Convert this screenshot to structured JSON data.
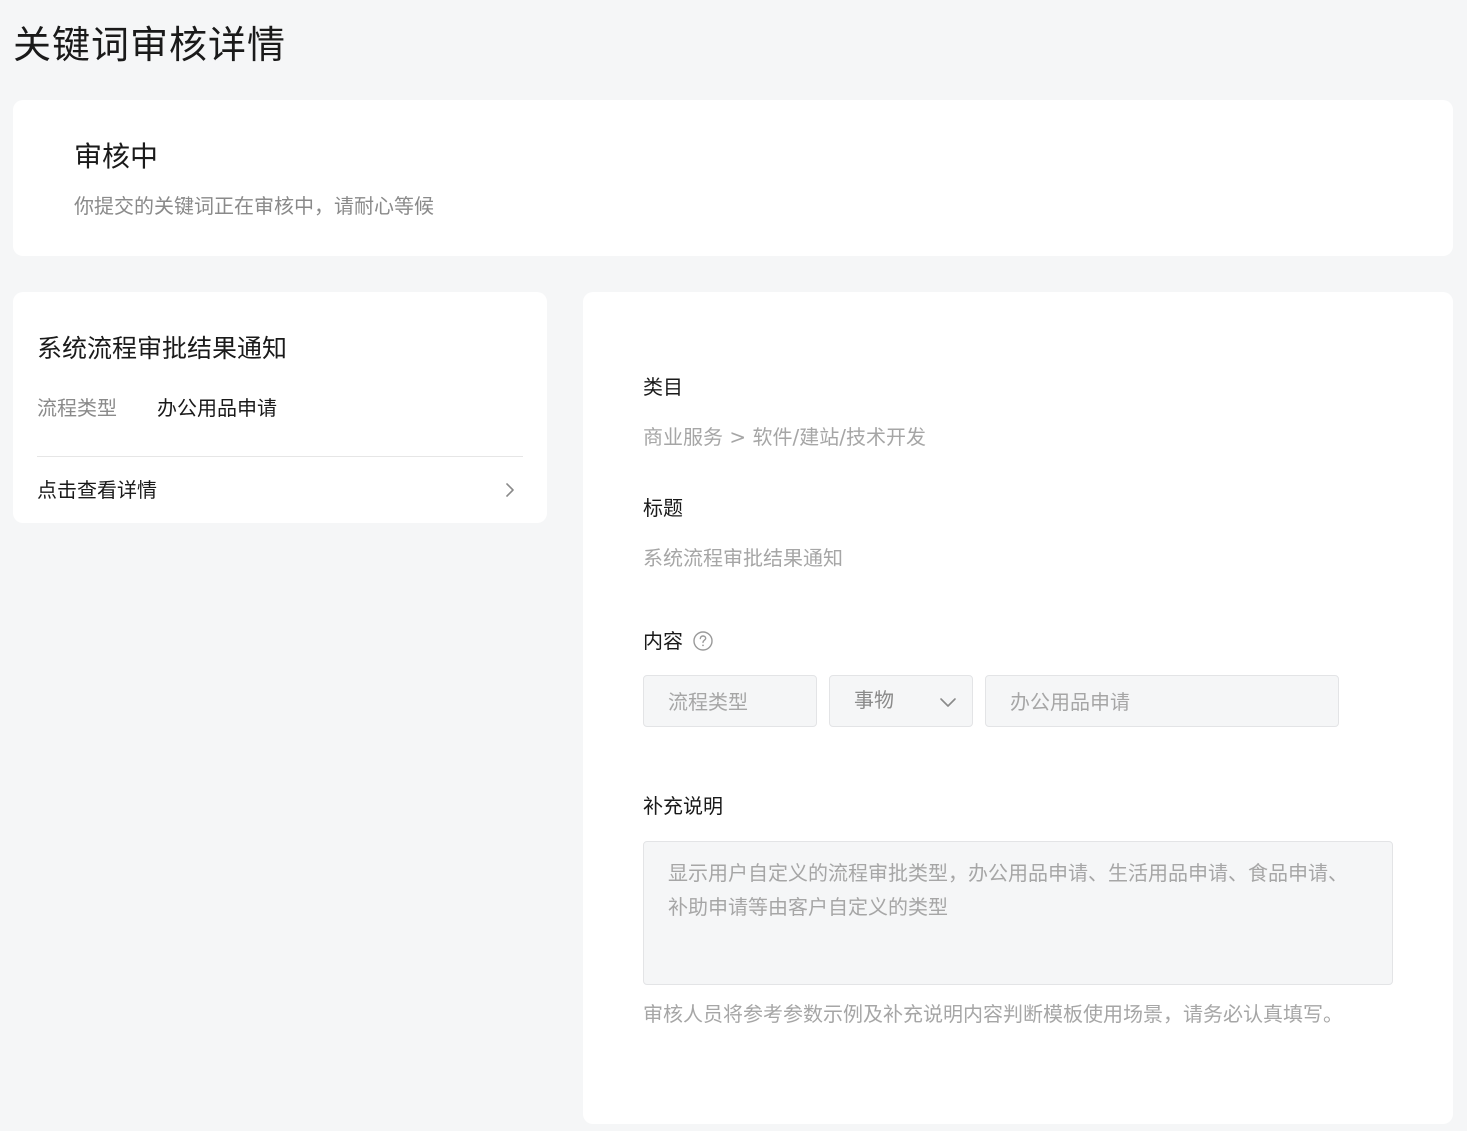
{
  "page": {
    "title": "关键词审核详情"
  },
  "status": {
    "title": "审核中",
    "description": "你提交的关键词正在审核中，请耐心等候"
  },
  "preview": {
    "title": "系统流程审批结果通知",
    "field_key": "流程类型",
    "field_value": "办公用品申请",
    "link_label": "点击查看详情",
    "link_icon": "chevron-right-icon"
  },
  "form": {
    "category": {
      "label": "类目",
      "value": "商业服务 > 软件/建站/技术开发"
    },
    "title": {
      "label": "标题",
      "value": "系统流程审批结果通知"
    },
    "content": {
      "label": "内容",
      "help_icon": "question-circle-icon",
      "param_name": "流程类型",
      "param_type": "事物",
      "param_example": "办公用品申请"
    },
    "note": {
      "label": "补充说明",
      "value": "显示用户自定义的流程审批类型，办公用品申请、生活用品申请、食品申请、补助申请等由客户自定义的类型",
      "hint": "审核人员将参考参数示例及补充说明内容判断模板使用场景，请务必认真填写。"
    }
  },
  "colors": {
    "background": "#f5f6f7",
    "card": "#ffffff",
    "text_primary": "#1a1a1a",
    "text_secondary": "#8a8a8a",
    "text_disabled": "#a6a6a6",
    "input_bg": "#f5f6f7",
    "border": "#e3e4e6"
  }
}
